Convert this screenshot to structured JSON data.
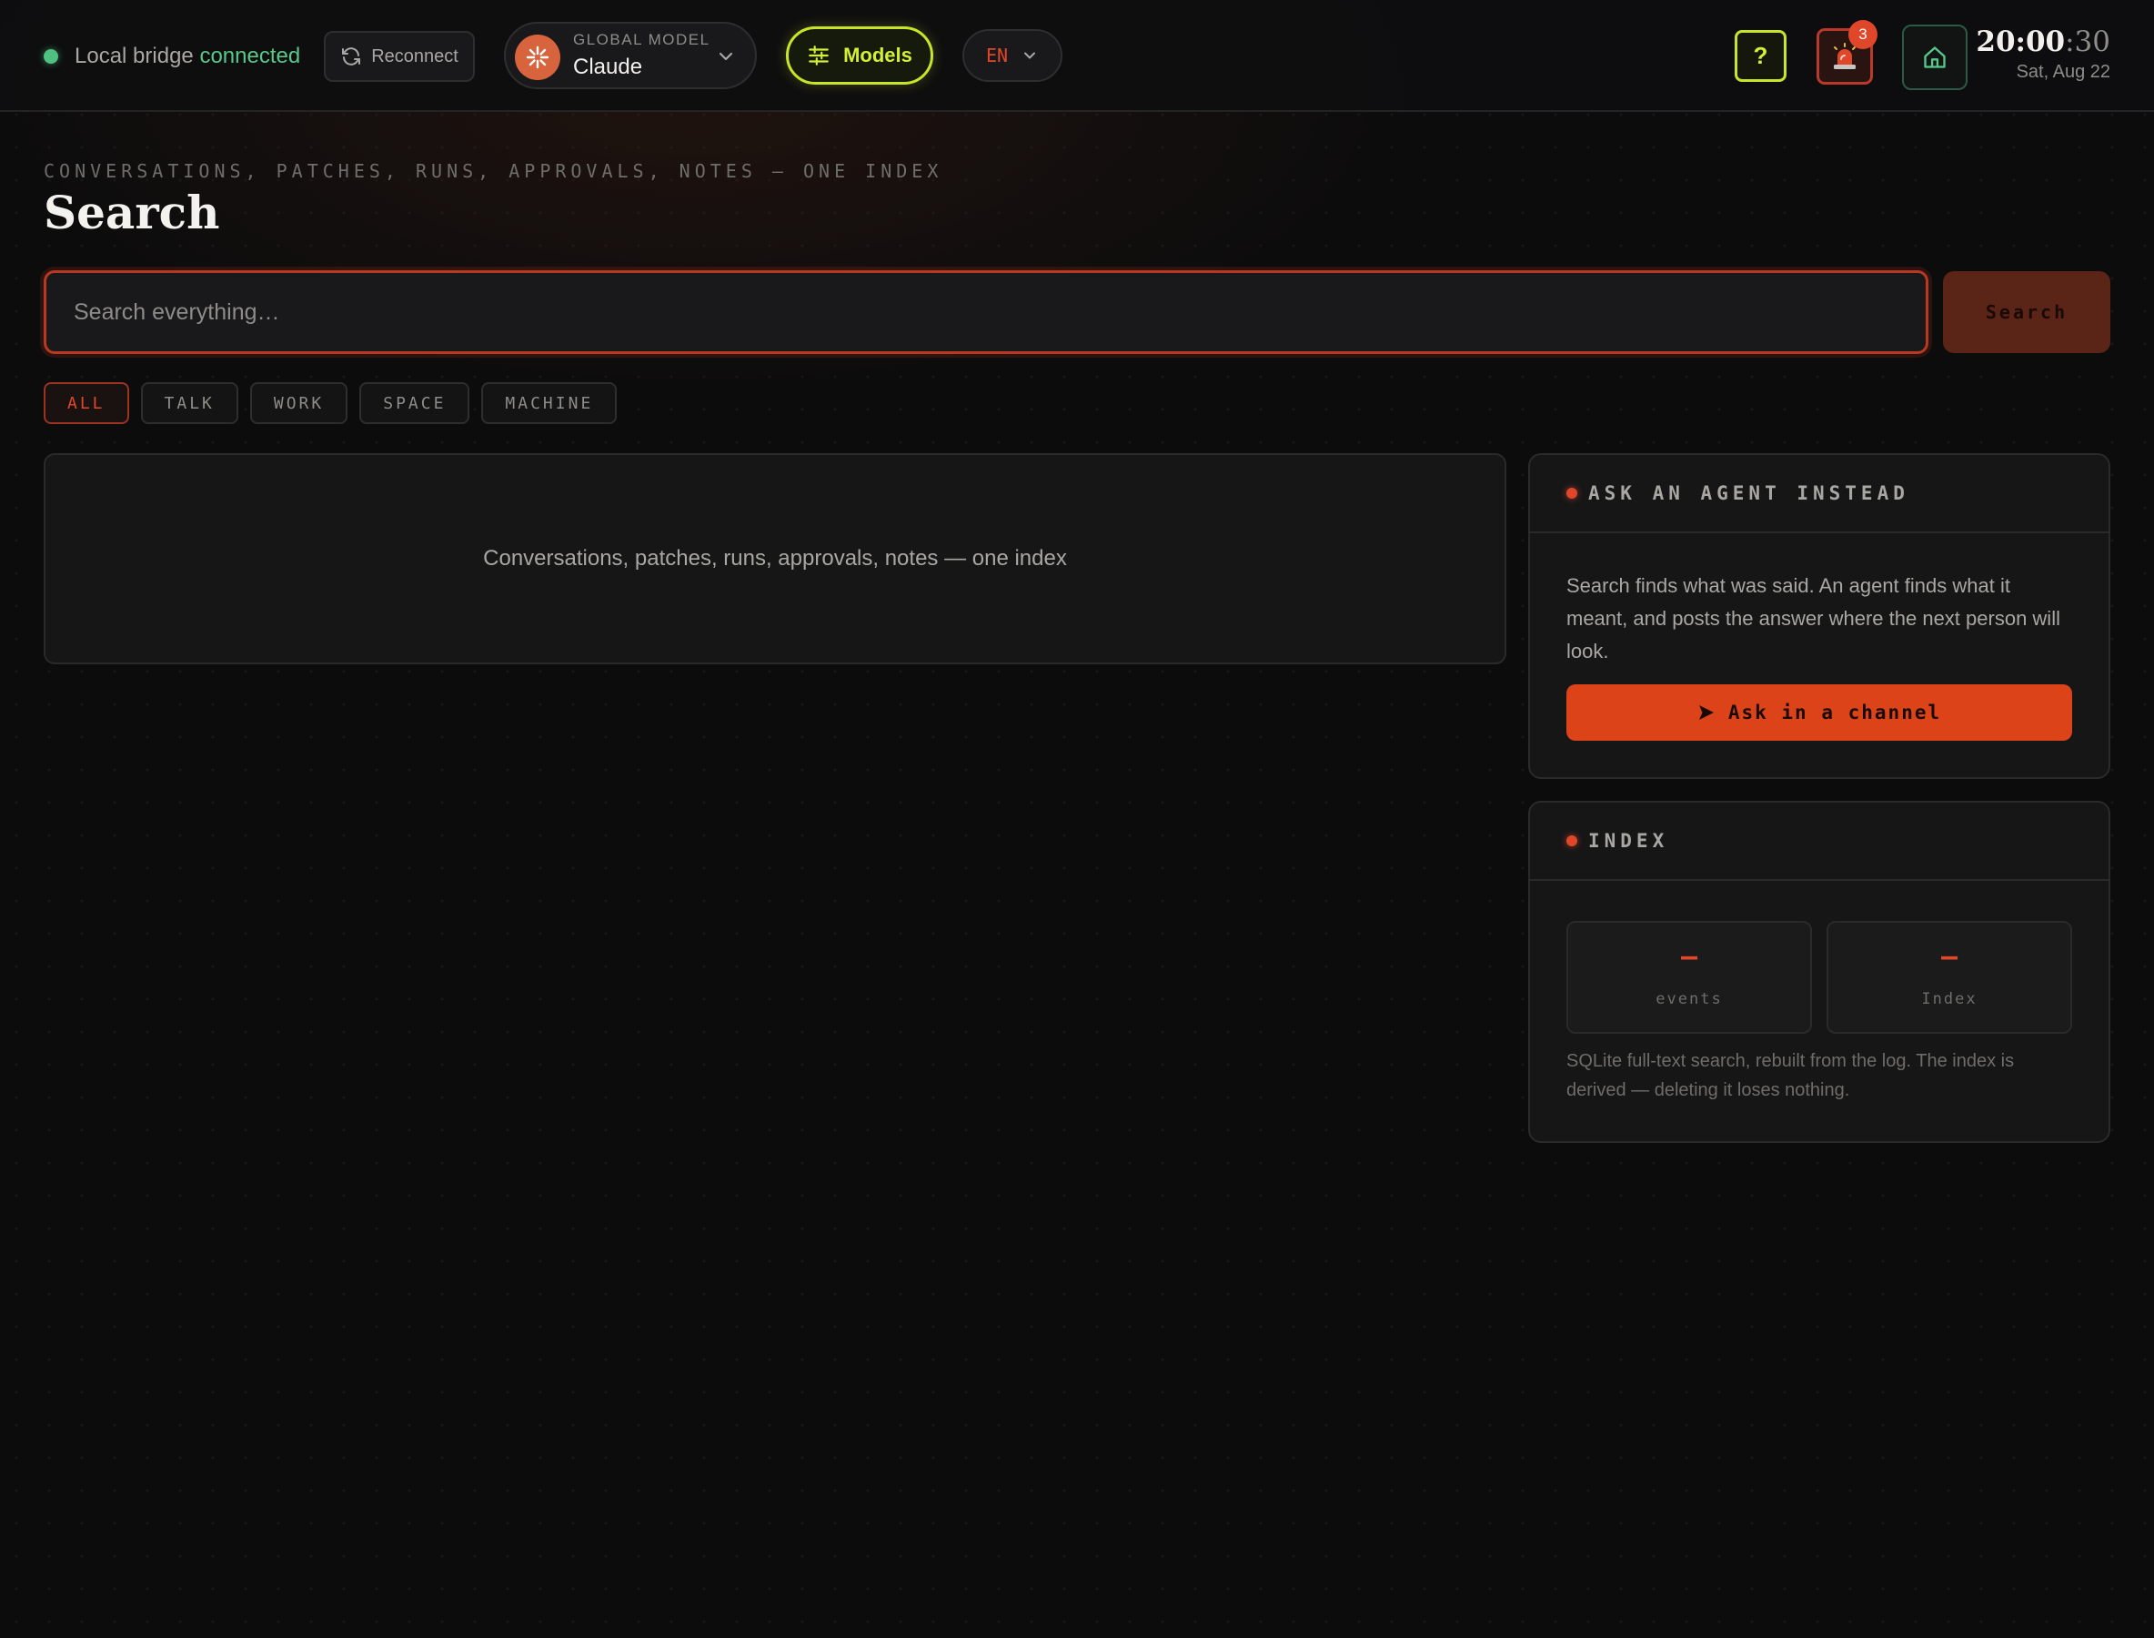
{
  "topbar": {
    "bridge_label": "Local bridge",
    "bridge_status": "connected",
    "reconnect_label": "Reconnect",
    "model_caption": "GLOBAL MODEL",
    "model_name": "Claude",
    "models_label": "Models",
    "language": "EN",
    "help_label": "?",
    "alert_count": "3",
    "clock_hm": "20:00",
    "clock_sec": ":30",
    "clock_date": "Sat, Aug 22"
  },
  "header": {
    "eyebrow": "CONVERSATIONS, PATCHES, RUNS, APPROVALS, NOTES — ONE INDEX",
    "title": "Search"
  },
  "search": {
    "placeholder": "Search everything…",
    "value": "",
    "button_label": "Search"
  },
  "filters": [
    {
      "label": "ALL",
      "active": true
    },
    {
      "label": "TALK",
      "active": false
    },
    {
      "label": "WORK",
      "active": false
    },
    {
      "label": "SPACE",
      "active": false
    },
    {
      "label": "MACHINE",
      "active": false
    }
  ],
  "results": {
    "empty_text": "Conversations, patches, runs, approvals, notes — one index"
  },
  "ask_panel": {
    "heading": "ASK AN AGENT INSTEAD",
    "body": "Search finds what was said. An agent finds what it meant, and posts the answer where the next person will look.",
    "button_label": "Ask in a channel"
  },
  "index_panel": {
    "heading": "INDEX",
    "stats": [
      {
        "value": "–",
        "label": "events"
      },
      {
        "value": "–",
        "label": "Index"
      }
    ],
    "note": "SQLite full-text search, rebuilt from the log. The index is derived — deleting it loses nothing."
  },
  "icons": {
    "status": "connection-dot-icon",
    "reconnect": "refresh-icon",
    "model": "claude-logo-icon",
    "models": "sliders-icon",
    "alert": "siren-icon",
    "home": "home-icon",
    "ask": "send-arrow-icon"
  },
  "colors": {
    "accent": "#e0472a",
    "lime": "#d4ef34",
    "success": "#58c78a",
    "background": "#0c0c0d"
  }
}
